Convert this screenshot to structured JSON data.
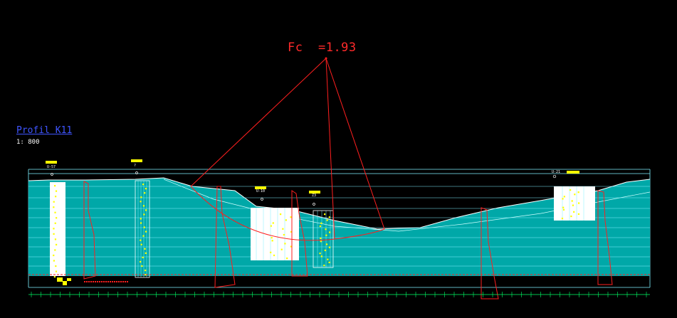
{
  "drawing": {
    "title": "Profil K11",
    "scale": "1: 800",
    "factor_label": "Fc",
    "factor_value": "=1.93"
  },
  "boreholes": [
    {
      "label": "U-57"
    },
    {
      "label": "?"
    },
    {
      "label": "U-10"
    },
    {
      "label": "Z3"
    },
    {
      "label": "U-21"
    }
  ],
  "colors": {
    "background": "#000000",
    "soil_fill": "#00a8a8",
    "grid_line": "#7ff0ff",
    "failure_line": "#ff1f1f",
    "yellow_marker": "#ffff00",
    "borehole_fill": "#ffffff"
  },
  "icons": [
    "borehole-symbol-icon"
  ]
}
